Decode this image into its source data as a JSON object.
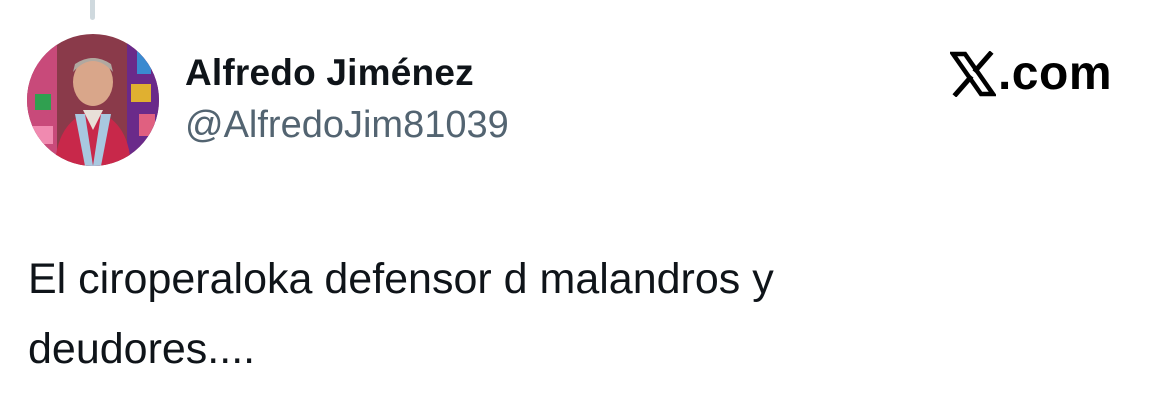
{
  "author": {
    "display_name": "Alfredo Jiménez",
    "handle": "@AlfredoJim81039",
    "avatar_description_icon": "profile-photo"
  },
  "brand": {
    "logo_icon": "x-logo-icon",
    "text": ".com"
  },
  "tweet": {
    "lines": [
      "El ciroperaloka defensor d malandros y",
      "deudores...."
    ]
  },
  "colors": {
    "text_primary": "#0f1419",
    "text_secondary": "#536471",
    "thread_line": "#cfd9de",
    "background": "#ffffff"
  }
}
